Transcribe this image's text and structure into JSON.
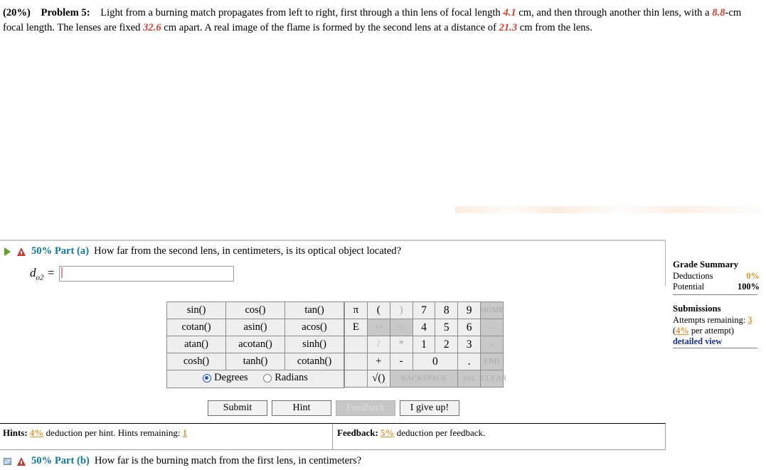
{
  "problem": {
    "percent": "(20%)",
    "title": "Problem 5:",
    "text_1": "Light from a burning match propagates from left to right, first through a thin lens of focal length",
    "focal_1": "4.1",
    "text_2": "cm, and then through another thin lens, with a",
    "focal_2": "8.8",
    "text_3": "-cm focal length. The lenses are fixed",
    "separation": "32.6",
    "text_4": "cm apart. A real image of the flame is formed by the second lens at a distance of",
    "image_distance": "21.3",
    "text_5": "cm from the lens."
  },
  "part_a": {
    "weight": "50% Part (a)",
    "question": "How far from the second lens, in centimeters, is its optical object located?",
    "variable": "d",
    "variable_sub": "o2",
    "equals": "=",
    "input_value": "",
    "input_placeholder": ""
  },
  "part_b": {
    "weight": "50% Part (b)",
    "question": "How far is the burning match from the first lens, in centimeters?"
  },
  "keypad": {
    "trig_rows": [
      [
        "sin()",
        "cos()",
        "tan()"
      ],
      [
        "cotan()",
        "asin()",
        "acos()"
      ],
      [
        "atan()",
        "acotan()",
        "sinh()"
      ],
      [
        "cosh()",
        "tanh()",
        "cotanh()"
      ]
    ],
    "angle_mode": {
      "degrees_label": "Degrees",
      "radians_label": "Radians",
      "selected": "Degrees"
    },
    "num_rows": [
      [
        {
          "label": "π",
          "state": "enabled",
          "span": 1,
          "cls": "sym"
        },
        {
          "label": "(",
          "state": "enabled",
          "span": 1,
          "cls": "sym"
        },
        {
          "label": ")",
          "state": "disabled",
          "span": 1,
          "cls": "sym"
        },
        {
          "label": "7",
          "state": "enabled",
          "span": 1,
          "cls": "digit"
        },
        {
          "label": "8",
          "state": "enabled",
          "span": 1,
          "cls": "digit"
        },
        {
          "label": "9",
          "state": "enabled",
          "span": 1,
          "cls": "digit"
        },
        {
          "label": "HOME",
          "state": "disabled",
          "span": 1,
          "cls": "small"
        }
      ],
      [
        {
          "label": "E",
          "state": "enabled",
          "span": 1,
          "cls": "sym"
        },
        {
          "label": "↑^",
          "state": "disabled",
          "span": 1,
          "cls": "arrowdis"
        },
        {
          "label": "^↓",
          "state": "disabled",
          "span": 1,
          "cls": "arrowdis"
        },
        {
          "label": "4",
          "state": "enabled",
          "span": 1,
          "cls": "digit"
        },
        {
          "label": "5",
          "state": "enabled",
          "span": 1,
          "cls": "digit"
        },
        {
          "label": "6",
          "state": "enabled",
          "span": 1,
          "cls": "digit"
        },
        {
          "label": "←",
          "state": "disabled",
          "span": 1,
          "cls": "small"
        }
      ],
      [
        {
          "label": "",
          "state": "blank",
          "span": 1,
          "cls": "blank"
        },
        {
          "label": "/",
          "state": "disabled",
          "span": 1,
          "cls": "sym"
        },
        {
          "label": "*",
          "state": "disabled",
          "span": 1,
          "cls": "sym"
        },
        {
          "label": "1",
          "state": "enabled",
          "span": 1,
          "cls": "digit"
        },
        {
          "label": "2",
          "state": "enabled",
          "span": 1,
          "cls": "digit"
        },
        {
          "label": "3",
          "state": "enabled",
          "span": 1,
          "cls": "digit"
        },
        {
          "label": "→",
          "state": "disabled",
          "span": 1,
          "cls": "small"
        }
      ],
      [
        {
          "label": "",
          "state": "blank",
          "span": 1,
          "cls": "blank"
        },
        {
          "label": "+",
          "state": "enabled",
          "span": 1,
          "cls": "sym"
        },
        {
          "label": "-",
          "state": "enabled",
          "span": 1,
          "cls": "sym"
        },
        {
          "label": "0",
          "state": "enabled",
          "span": 2,
          "cls": "digit wide"
        },
        {
          "label": ".",
          "state": "enabled",
          "span": 1,
          "cls": "digit"
        },
        {
          "label": "END",
          "state": "disabled",
          "span": 1,
          "cls": "small"
        }
      ],
      [
        {
          "label": "",
          "state": "blank",
          "span": 1,
          "cls": "blank"
        },
        {
          "label": "√()",
          "state": "enabled",
          "span": 1,
          "cls": "sym"
        },
        {
          "label": "BACKSPACE",
          "state": "disabled",
          "span": 3,
          "cls": "small"
        },
        {
          "label": "DEL",
          "state": "disabled",
          "span": 1,
          "cls": "tiny"
        },
        {
          "label": "CLEAR",
          "state": "disabled",
          "span": 1,
          "cls": "small"
        }
      ]
    ]
  },
  "actions": {
    "submit": "Submit",
    "hint": "Hint",
    "feedback": "Feedback",
    "give_up": "I give up!",
    "feedback_disabled": true
  },
  "hints_bar": {
    "hints_label": "Hints:",
    "hints_pct": "4%",
    "hints_text_1": "deduction per hint. Hints remaining:",
    "hints_remaining": "1",
    "feedback_label": "Feedback:",
    "feedback_pct": "5%",
    "feedback_text": "deduction per feedback."
  },
  "grade_summary": {
    "title": "Grade Summary",
    "deductions_label": "Deductions",
    "deductions_value": "0%",
    "potential_label": "Potential",
    "potential_value": "100%"
  },
  "submissions": {
    "title": "Submissions",
    "attempts_label": "Attempts remaining:",
    "attempts_value": "3",
    "per_attempt_open": "(",
    "per_attempt_pct": "4%",
    "per_attempt_text": "per attempt)",
    "detailed_view": "detailed view"
  },
  "colors": {
    "accent_red": "#e8392a",
    "accent_orange": "#e8962c",
    "part_teal": "#0d7b9e",
    "link_blue": "#1a2f9e"
  }
}
